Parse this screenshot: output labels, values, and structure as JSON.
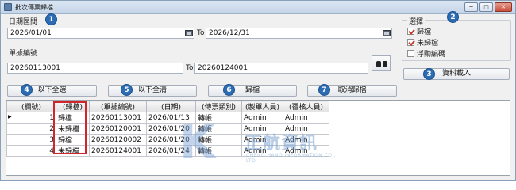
{
  "window": {
    "title": "批次傳票歸檔",
    "min_label": "─",
    "max_label": "□",
    "close_label": "✕"
  },
  "filters": {
    "date_range_label": "日期區間",
    "date_from": "2026/01/01",
    "date_to": "2026/12/31",
    "to_label_1": "To",
    "doc_no_label": "單據編號",
    "doc_from": "20260113001",
    "doc_to": "20260124001",
    "to_label_2": "To"
  },
  "select_panel": {
    "title": "選擇",
    "options": [
      {
        "label": "歸檔",
        "checked": true
      },
      {
        "label": "未歸檔",
        "checked": true
      },
      {
        "label": "浮動編碼",
        "checked": false
      }
    ],
    "load_button": "資料載入"
  },
  "actions": {
    "select_all": "以下全選",
    "clear_all": "以下全清",
    "archive": "歸檔",
    "unarchive": "取消歸檔"
  },
  "badges": [
    "1",
    "2",
    "3",
    "4",
    "5",
    "6",
    "7"
  ],
  "grid": {
    "columns": [
      "(欄號)",
      "(歸檔)",
      "(單據編號)",
      "(日期)",
      "(傳票類別)",
      "(製單人員)",
      "(覆核人員)"
    ],
    "rows": [
      {
        "no": "1",
        "status": "歸檔",
        "doc": "20260113001",
        "date": "2026/01/13",
        "type": "轉帳",
        "maker": "Admin",
        "checker": "Admin"
      },
      {
        "no": "2",
        "status": "未歸檔",
        "doc": "20260120001",
        "date": "2026/01/20",
        "type": "轉帳",
        "maker": "Admin",
        "checker": "Admin"
      },
      {
        "no": "3",
        "status": "歸檔",
        "doc": "20260120002",
        "date": "2026/01/20",
        "type": "轉帳",
        "maker": "Admin",
        "checker": "Admin"
      },
      {
        "no": "4",
        "status": "未歸檔",
        "doc": "20260124001",
        "date": "2026/01/24",
        "type": "轉帳",
        "maker": "Admin",
        "checker": "Admin"
      }
    ],
    "current_row_marker": "▶"
  },
  "watermark": {
    "mark": "K",
    "name": "正航資訊",
    "company": "CHENG HANG INFORMATION CO., LTD"
  },
  "colors": {
    "badge": "#2b6cb4",
    "highlight_box": "#d0262b",
    "check_mark": "#c0392b"
  }
}
